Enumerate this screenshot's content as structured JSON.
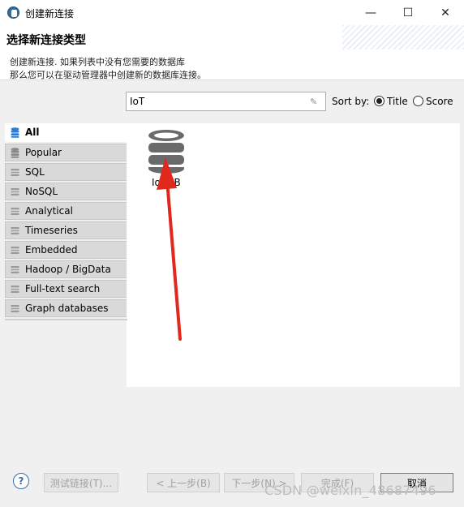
{
  "window": {
    "title": "创建新连接",
    "minimize_glyph": "—",
    "maximize_glyph": "☐",
    "close_glyph": "✕"
  },
  "header": {
    "title": "选择新连接类型",
    "line1": "创建新连接. 如果列表中没有您需要的数据库",
    "line2": "那么您可以在驱动管理器中创建新的数据库连接。"
  },
  "search": {
    "value": "IoT"
  },
  "sort": {
    "label": "Sort by:",
    "options": [
      {
        "label": "Title",
        "selected": true
      },
      {
        "label": "Score",
        "selected": false
      }
    ]
  },
  "categories": [
    {
      "label": "All",
      "active": true
    },
    {
      "label": "Popular"
    },
    {
      "label": "SQL"
    },
    {
      "label": "NoSQL"
    },
    {
      "label": "Analytical"
    },
    {
      "label": "Timeseries"
    },
    {
      "label": "Embedded"
    },
    {
      "label": "Hadoop / BigData"
    },
    {
      "label": "Full-text search"
    },
    {
      "label": "Graph databases"
    }
  ],
  "drivers": [
    {
      "label": "IoTDB",
      "icon": "database-icon"
    }
  ],
  "footer": {
    "help_glyph": "?",
    "test_button": "测试链接(T)...",
    "back_button": "< 上一步(B)",
    "next_button": "下一步(N) >",
    "finish_button": "完成(F)",
    "cancel_button": "取消"
  },
  "watermark": "CSDN @weixin_48687496",
  "colors": {
    "arrow": "#e0281c",
    "db_icon": "#6a6a6a",
    "tab_icon_active": "#2e7bd6"
  }
}
